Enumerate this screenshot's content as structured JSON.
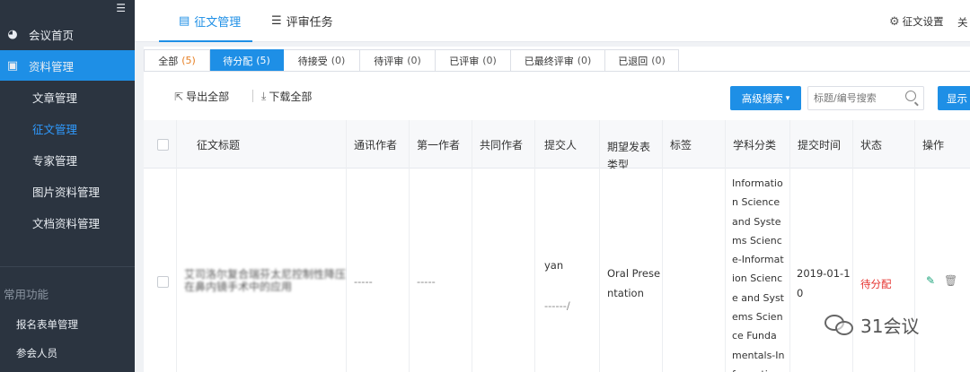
{
  "sidebar": {
    "collapse_icon": "collapse-menu-icon",
    "items": [
      {
        "label": "会议首页",
        "icon": "dashboard-icon"
      },
      {
        "label": "资料管理",
        "icon": "picture-folder-icon"
      }
    ],
    "sub_items": [
      {
        "label": "文章管理"
      },
      {
        "label": "征文管理"
      },
      {
        "label": "专家管理"
      },
      {
        "label": "图片资料管理"
      },
      {
        "label": "文档资料管理"
      }
    ],
    "section_title": "常用功能",
    "small_items": [
      {
        "label": "报名表单管理"
      },
      {
        "label": "参会人员"
      }
    ]
  },
  "header": {
    "tabs": [
      {
        "label": "征文管理",
        "icon": "form-icon"
      },
      {
        "label": "评审任务",
        "icon": "list-icon"
      }
    ],
    "settings_label": "征文设置",
    "close_label": "关"
  },
  "status_tabs": [
    {
      "label": "全部",
      "count": "(5)"
    },
    {
      "label": "待分配",
      "count": "(5)"
    },
    {
      "label": "待接受",
      "count": "(0)"
    },
    {
      "label": "待评审",
      "count": "(0)"
    },
    {
      "label": "已评审",
      "count": "(0)"
    },
    {
      "label": "已最终评审",
      "count": "(0)"
    },
    {
      "label": "已退回",
      "count": "(0)"
    }
  ],
  "toolbar": {
    "export_all": "导出全部",
    "download_all": "下载全部",
    "advanced_search": "高级搜索",
    "search_placeholder": "标题/编号搜索",
    "show_label": "显示"
  },
  "table": {
    "columns": [
      "征文标题",
      "通讯作者",
      "第一作者",
      "共同作者",
      "提交人",
      "期望发表类型",
      "标签",
      "学科分类",
      "提交时间",
      "状态",
      "操作"
    ],
    "column_type_line1": "期望发表",
    "column_type_line2": "类型",
    "rows": [
      {
        "title_line1": "艾司洛尔复合瑞芬太尼控制性降压",
        "title_line2": "在鼻内镜手术中的应用",
        "corresponding_author": "-----",
        "first_author": "-----",
        "co_author": "",
        "submitter_line1": "yan",
        "submitter_line2": "------/",
        "pub_type_line1": "Oral Prese",
        "pub_type_line2": "ntation",
        "tag": "",
        "subject": "Information Science and Systems Science-Information Science and Systems Science Fundamentals-Informati",
        "date_line1": "2019-01-1",
        "date_line2": "0",
        "status": "待分配"
      }
    ]
  },
  "watermark": {
    "text": "31会议"
  },
  "colors": {
    "primary": "#1e8fe6",
    "sidebar_bg": "#2b3440",
    "status_red": "#e5302c"
  }
}
